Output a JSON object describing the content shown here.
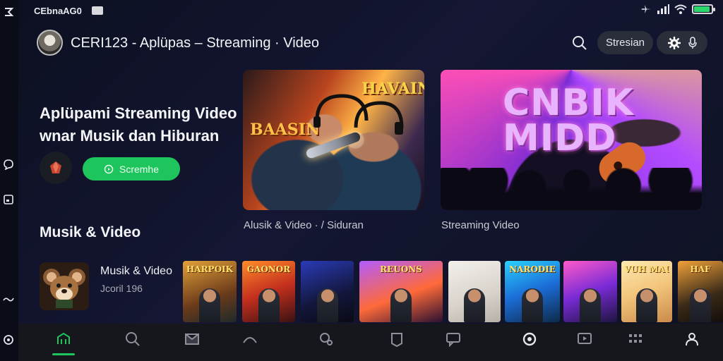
{
  "status_bar": {
    "carrier": "CEbnaAG0",
    "icons": [
      "carrier-badge-icon",
      "airplane-icon",
      "signal-icon",
      "wifi-icon",
      "battery-icon"
    ],
    "battery_level": 0.9,
    "battery_color": "#2bd66a"
  },
  "side_rail": {
    "icons": [
      "app-logo-icon",
      "chat-bubble-icon",
      "window-icon",
      "wave-icon",
      "record-icon"
    ]
  },
  "header": {
    "title": "CERI123 - Aplüpas – Streaming · Video",
    "search_icon": "search-icon",
    "pill_label": "Stresian",
    "pill_icons": [
      "gear-icon",
      "mic-icon"
    ]
  },
  "hero": {
    "heading": "Aplüpami Streaming Video",
    "subheading": "wnar Musik dan Hiburan",
    "logo_icon": "gem-icon",
    "button_label": "Scremhe",
    "button_icon": "play-circle-icon",
    "accent_color": "#1ec55c"
  },
  "featured": [
    {
      "poster_text_a": "HAVAIN",
      "poster_text_b": "BAASIN",
      "caption": "Alusik & Video · / Siduran"
    },
    {
      "poster_text": "CNBIK MIDD",
      "caption": "Streaming Video"
    }
  ],
  "section": {
    "title": "Musik & Video"
  },
  "album": {
    "title": "Musik & Video",
    "subtitle": "Jcoril 196",
    "art_icon": "mouse-mascot-icon"
  },
  "thumbnails": [
    {
      "label": "HARPOIK",
      "bg": "linear-gradient(160deg,#e2a13a,#6b3a1a 60%,#1e2a2a)"
    },
    {
      "label": "GAONOR",
      "bg": "linear-gradient(160deg,#ff8c2a,#c42f1e 50%,#3a1212)"
    },
    {
      "label": "",
      "bg": "linear-gradient(160deg,#2a3bb8,#12163a 60%,#0a0a14)"
    },
    {
      "label": "REUONS",
      "bg": "linear-gradient(160deg,#b25cff,#ff6a3a 55%,#2a1030)"
    },
    {
      "label": "",
      "bg": "linear-gradient(160deg,#f3f0ec,#d8d2c9 60%,#b8b0a6)"
    },
    {
      "label": "NARODIE",
      "bg": "linear-gradient(160deg,#2ad0ff,#1b6cd6 50%,#0e2a4a)"
    },
    {
      "label": "",
      "bg": "linear-gradient(160deg,#ff5ac8,#7a2bd6 50%,#1e1440)"
    },
    {
      "label": "VUH MAUS",
      "bg": "linear-gradient(160deg,#ffe9b0,#f2c47a 50%,#c98a4a)"
    },
    {
      "label": "HAF",
      "bg": "linear-gradient(160deg,#f2a23a,#3a2a18 60%,#120e0a)"
    }
  ],
  "bottom_nav": {
    "items": [
      "home-icon",
      "search-icon",
      "library-icon",
      "dome-icon",
      "discover-icon",
      "tag-icon",
      "chat-icon",
      "live-icon",
      "video-icon",
      "grid-icon",
      "profile-icon"
    ],
    "active_index": 0
  }
}
